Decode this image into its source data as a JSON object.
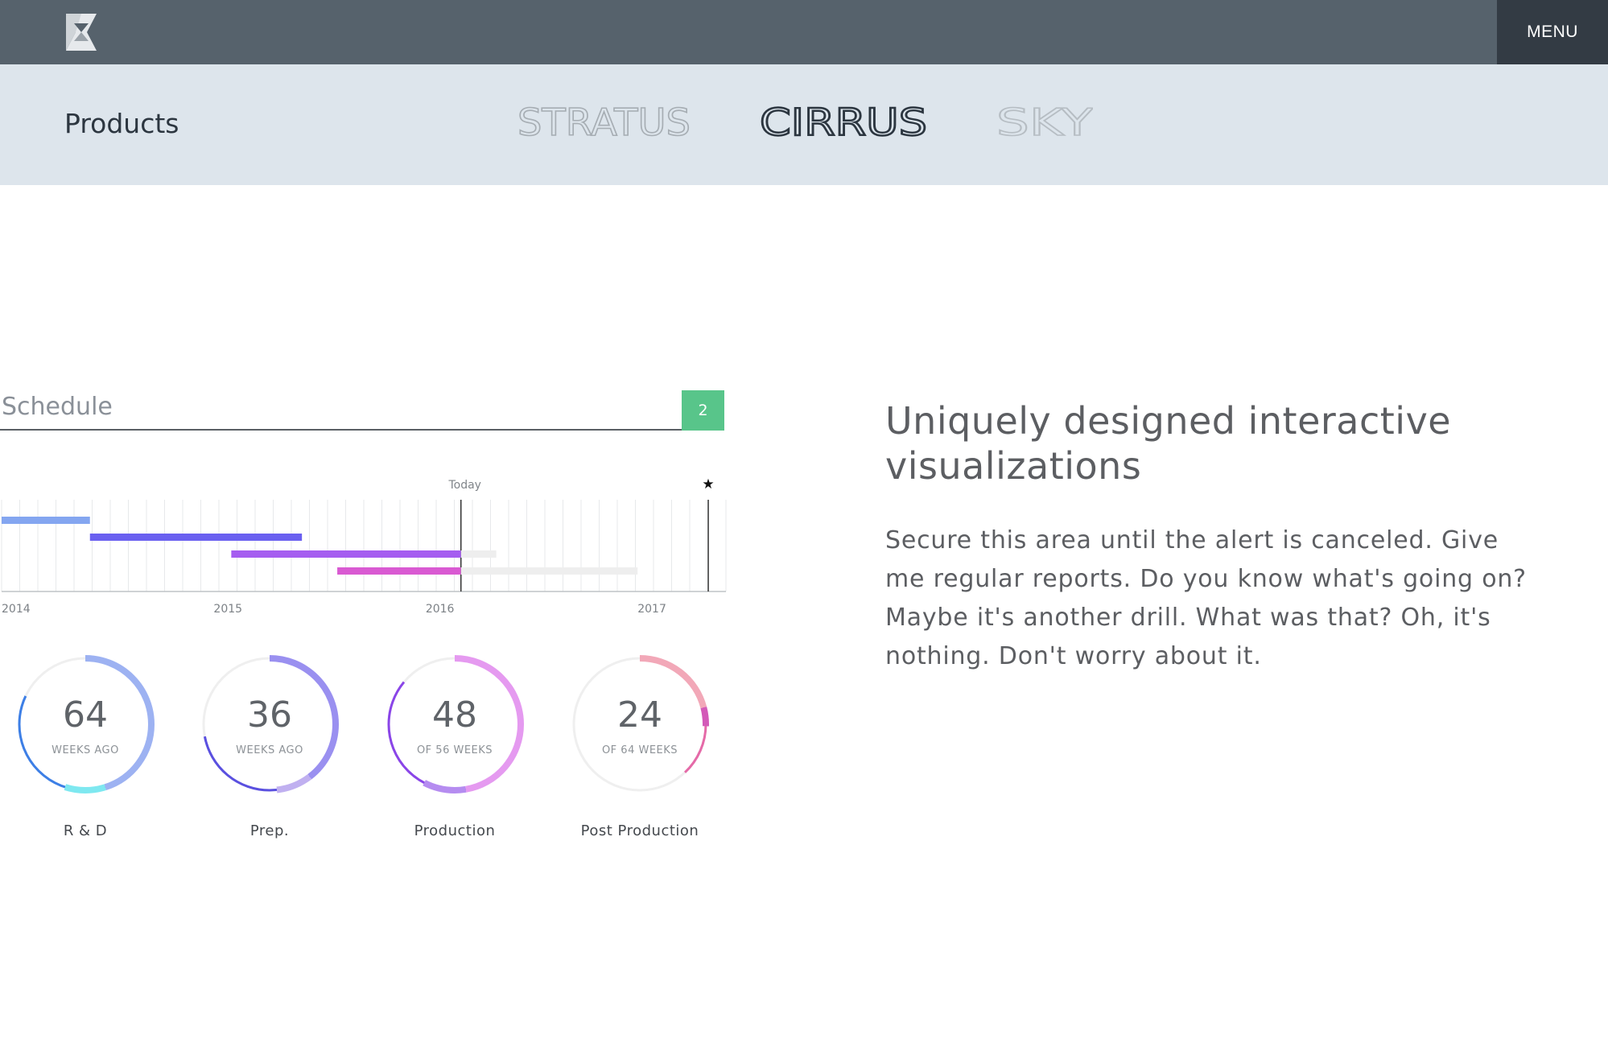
{
  "header": {
    "logo_icon": "hourglass-logo-icon",
    "menu_label": "MENU"
  },
  "subnav": {
    "section_title": "Products",
    "products": [
      {
        "label": "STRATUS",
        "state": "inactive"
      },
      {
        "label": "CIRRUS",
        "state": "active"
      },
      {
        "label": "SKY",
        "state": "inactive"
      }
    ]
  },
  "schedule": {
    "label": "Schedule",
    "badge": "2",
    "today_label": "Today",
    "milestone_icon": "star-icon"
  },
  "chart_data": [
    {
      "type": "bar",
      "subtype": "gantt",
      "x_ticks": [
        "2014",
        "2015",
        "2016",
        "2017"
      ],
      "xlim": [
        "2014-01",
        "2017-06"
      ],
      "today": "2016-03",
      "milestone": "2017-05",
      "series": [
        {
          "name": "R & D",
          "start": "2014-01",
          "end": "2014-06",
          "color": "#84a6f0"
        },
        {
          "name": "Prep.",
          "start": "2014-06",
          "end": "2015-06",
          "color": "#6a60f0"
        },
        {
          "name": "Production",
          "start": "2015-02",
          "end": "2016-03",
          "planned_end": "2016-05",
          "color": "#a55df0"
        },
        {
          "name": "Post Production",
          "start": "2015-08",
          "end": "2016-03",
          "planned_end": "2017-01",
          "color": "#d95ad2"
        }
      ]
    },
    {
      "type": "pie",
      "subtype": "radial-progress",
      "items": [
        {
          "name": "R & D",
          "value": "64",
          "caption": "WEEKS AGO",
          "fraction": 0.82,
          "colors": [
            "#9db2f2",
            "#3d7fe6",
            "#7ee8f0"
          ]
        },
        {
          "name": "Prep.",
          "value": "36",
          "caption": "WEEKS AGO",
          "fraction": 0.72,
          "colors": [
            "#9a90f0",
            "#5a50e0",
            "#c0b0f0"
          ]
        },
        {
          "name": "Production",
          "value": "48",
          "caption": "OF 56 WEEKS",
          "fraction": 0.86,
          "colors": [
            "#e59af0",
            "#8a45e8",
            "#b58cf0"
          ]
        },
        {
          "name": "Post Production",
          "value": "24",
          "caption": "OF 64 WEEKS",
          "fraction": 0.38,
          "colors": [
            "#f2a8b8",
            "#e56aa8",
            "#d35ab8"
          ]
        }
      ]
    }
  ],
  "content": {
    "headline": "Uniquely designed interactive visualizations",
    "body": "Secure this area until the alert is canceled. Give me regular reports. Do you know what's going on? Maybe it's another drill. What was that? Oh, it's nothing. Don't worry about it."
  }
}
